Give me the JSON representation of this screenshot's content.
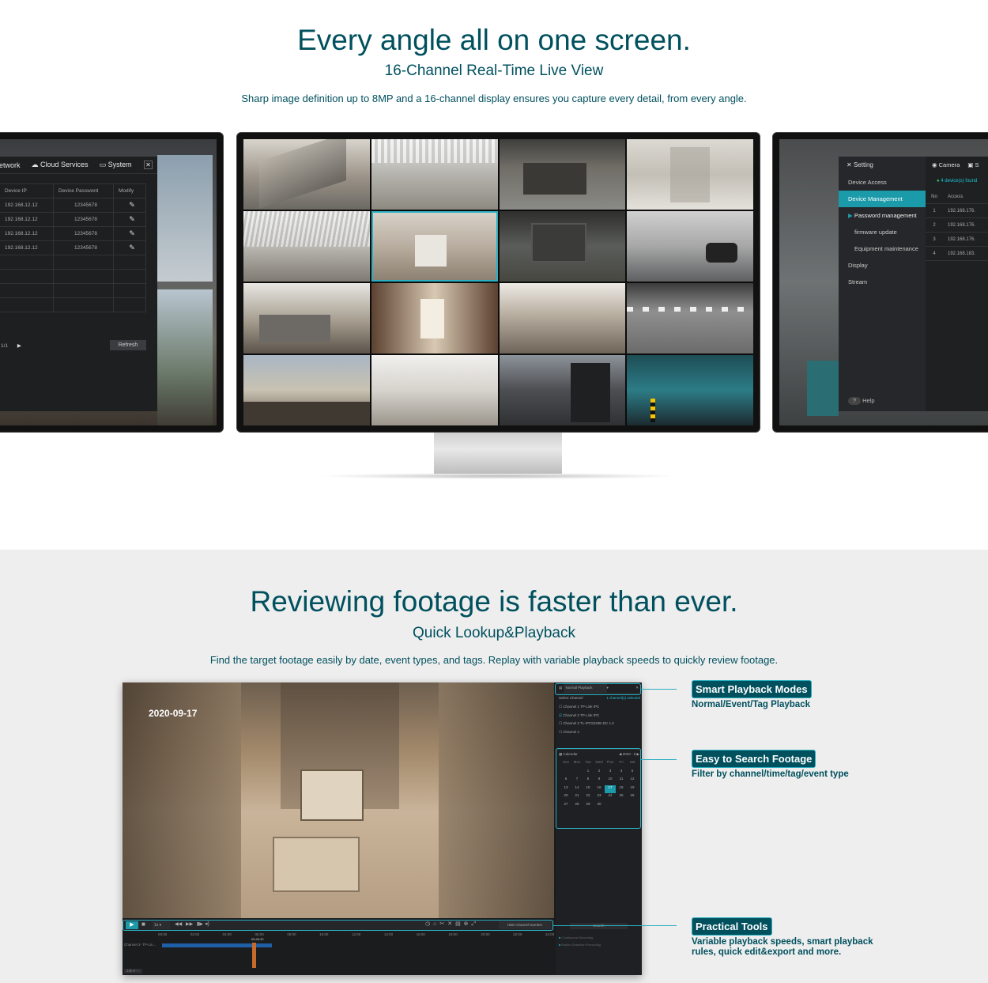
{
  "section1": {
    "title": "Every angle all on one screen.",
    "subtitle": "16-Channel Real-Time Live View",
    "description": "Sharp image definition up to 8MP and a 16-channel display ensures you capture every detail, from every angle."
  },
  "left_monitor": {
    "tabs": [
      "etwork",
      "Cloud Services",
      "System"
    ],
    "columns": [
      "Device IP",
      "Device Password",
      "Modify"
    ],
    "rows": [
      {
        "ip": "192.168.12.12",
        "pw": "12345678"
      },
      {
        "ip": "192.168.12.12",
        "pw": "12345678"
      },
      {
        "ip": "192.168.12.12",
        "pw": "12345678"
      },
      {
        "ip": "192.168.12.12",
        "pw": "12345678"
      }
    ],
    "page": "1/1",
    "refresh_label": "Refresh"
  },
  "right_monitor": {
    "setting_label": "Setting",
    "camera_tab": "Camera",
    "other_tab": "S",
    "found_text": "4 device(s) found",
    "menu": [
      "Device Access",
      "Device Management",
      "Password management",
      "firmware update",
      "Equipment maintenance",
      "Display",
      "Stream"
    ],
    "help_label": "Help",
    "columns": [
      "No",
      "Access"
    ],
    "rows": [
      {
        "no": "1",
        "ip": "192.168.176."
      },
      {
        "no": "2",
        "ip": "192.168.176."
      },
      {
        "no": "3",
        "ip": "192.168.176."
      },
      {
        "no": "4",
        "ip": "192.168.183."
      }
    ]
  },
  "section2": {
    "title": "Reviewing footage is faster than ever.",
    "subtitle": "Quick Lookup&Playback",
    "description": "Find the target footage easily by date, event types, and tags. Replay with variable playback speeds to quickly review footage."
  },
  "playback": {
    "timestamp": "2020-09-17",
    "mode_label": "Normal Playback",
    "select_channel": "Select Channel",
    "channels_selected": "1 channel(s) selected",
    "channels": [
      "Channel 1 TP-Link IPC",
      "Channel 2 TP-Link IPC",
      "Channel 3 TL-IPC5220E-DC 1.0",
      "Channel 4"
    ],
    "calendar_label": "Calendar",
    "calendar_month": "2020 - 9",
    "weekdays": [
      "Sun",
      "Mon",
      "Tue",
      "Wed",
      "Thur",
      "Fri",
      "Sat"
    ],
    "days": [
      "",
      "",
      "1",
      "2",
      "3",
      "4",
      "5",
      "6",
      "7",
      "8",
      "9",
      "10",
      "11",
      "12",
      "13",
      "14",
      "15",
      "16",
      "17",
      "18",
      "19",
      "20",
      "21",
      "22",
      "23",
      "24",
      "25",
      "26",
      "27",
      "28",
      "29",
      "30"
    ],
    "selected_day": "17",
    "speed": "1x",
    "hide_channel": "Hide Channel Number",
    "search_label": "Search",
    "times": [
      "00:00",
      "02:00",
      "04:00",
      "06:00",
      "08:00",
      "10:00",
      "12:00",
      "14:00",
      "16:00",
      "18:00",
      "20:00",
      "22:00",
      "24:00"
    ],
    "cursor_time": "05:45:32",
    "timeline_channel": "Channel 2- TP-Lin...",
    "zoom": "24h",
    "legend": [
      "Continuous Recording",
      "Motion Detection Recording"
    ]
  },
  "callouts": [
    {
      "tag": "Smart Playback Modes",
      "sub": "Normal/Event/Tag Playback"
    },
    {
      "tag": "Easy to Search Footage",
      "sub": "Filter by channel/time/tag/event type"
    },
    {
      "tag": "Practical Tools",
      "sub": "Variable playback speeds, smart playback rules, quick edit&export and more."
    }
  ],
  "colors": {
    "brand": "#00505e",
    "accent": "#2ab0c2",
    "active_menu": "#1b9aaa"
  }
}
